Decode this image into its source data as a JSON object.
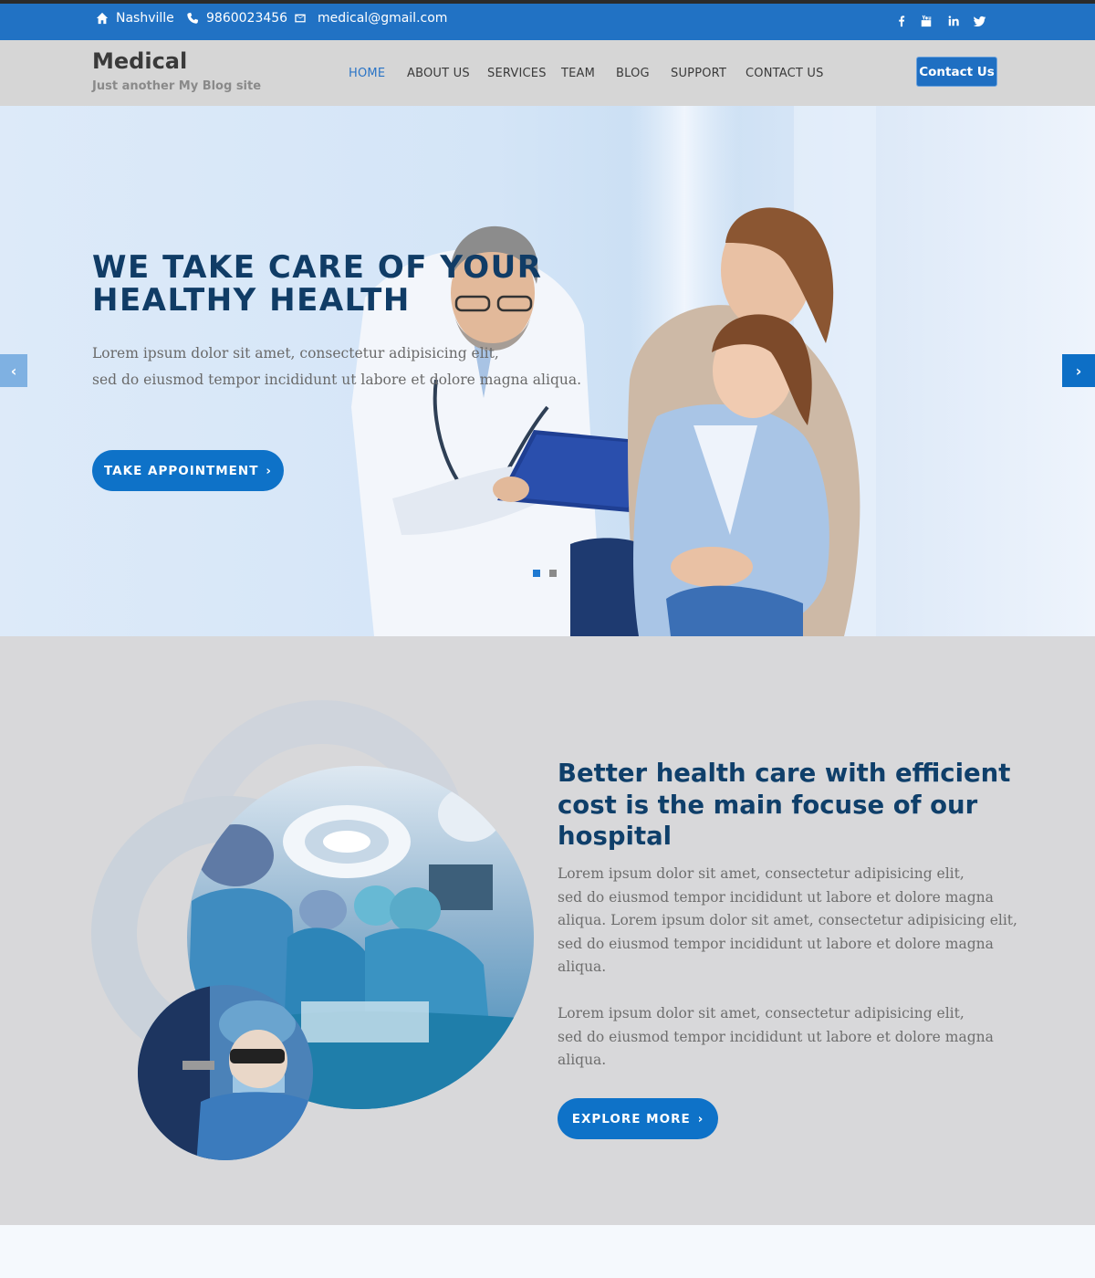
{
  "topbar": {
    "location": "Nashville",
    "phone": "9860023456",
    "email": "medical@gmail.com",
    "socials": [
      "facebook-icon",
      "youtube-icon",
      "linkedin-icon",
      "twitter-icon"
    ]
  },
  "header": {
    "brand_title": "Medical",
    "brand_tagline": "Just another My Blog site",
    "nav": [
      {
        "label": "HOME"
      },
      {
        "label": "ABOUT US"
      },
      {
        "label": "SERVICES"
      },
      {
        "label": "TEAM"
      },
      {
        "label": "BLOG"
      },
      {
        "label": "SUPPORT"
      },
      {
        "label": "CONTACT US"
      }
    ],
    "active_nav": "HOME",
    "contact_button": "Contact Us"
  },
  "hero": {
    "title_lines": [
      "WE TAKE CARE OF YOUR",
      "HEALTHY HEALTH"
    ],
    "text_lines": [
      "Lorem ipsum dolor sit amet, consectetur adipisicing elit,",
      "sed do eiusmod tempor incididunt ut labore et dolore magna aliqua."
    ],
    "button": "TAKE APPOINTMENT",
    "slides": 2,
    "active_slide": 1
  },
  "about": {
    "heading_lines": [
      "Better health care with efficient",
      "cost is the main focuse of our",
      "hospital"
    ],
    "paragraph1_lines": [
      "Lorem ipsum dolor sit amet, consectetur adipisicing elit,",
      "sed do eiusmod tempor incididunt ut labore et dolore magna",
      "aliqua. Lorem ipsum dolor sit amet, consectetur adipisicing elit,",
      "sed do eiusmod tempor incididunt ut labore et dolore magna",
      "aliqua."
    ],
    "paragraph2_lines": [
      "Lorem ipsum dolor sit amet, consectetur adipisicing elit,",
      "sed do eiusmod tempor incididunt ut labore et dolore magna",
      "aliqua."
    ],
    "button": "EXPLORE MORE"
  },
  "colors": {
    "primary": "#2172c4",
    "button": "#0e72c8",
    "heading": "#103c66",
    "header_bg": "#d6d6d6",
    "section_bg": "#d8d8da"
  }
}
